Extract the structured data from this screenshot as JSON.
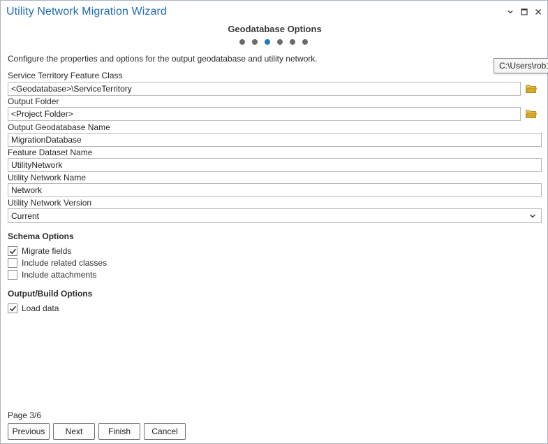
{
  "window": {
    "title": "Utility Network Migration Wizard",
    "minimize_icon": "chevron-down-icon",
    "maximize_icon": "maximize-icon",
    "close_icon": "close-icon"
  },
  "step": {
    "title": "Geodatabase Options",
    "total": 6,
    "current": 3
  },
  "intro": "Configure the properties and options for the output geodatabase and utility network.",
  "tooltip": "C:\\Users\\rob1",
  "fields": {
    "service_territory": {
      "label": "Service Territory Feature Class",
      "value": "<Geodatabase>\\ServiceTerritory"
    },
    "output_folder": {
      "label": "Output Folder",
      "value": "<Project Folder>"
    },
    "gdb_name": {
      "label": "Output Geodatabase Name",
      "value": "MigrationDatabase"
    },
    "dataset_name": {
      "label": "Feature Dataset Name",
      "value": "UtilityNetwork"
    },
    "network_name": {
      "label": "Utility Network Name",
      "value": "Network"
    },
    "network_version": {
      "label": "Utility Network Version",
      "value": "Current"
    }
  },
  "schema": {
    "title": "Schema Options",
    "options": [
      {
        "label": "Migrate fields",
        "checked": true
      },
      {
        "label": "Include related classes",
        "checked": false
      },
      {
        "label": "Include attachments",
        "checked": false
      }
    ]
  },
  "output": {
    "title": "Output/Build Options",
    "options": [
      {
        "label": "Load data",
        "checked": true
      }
    ]
  },
  "page_indicator": "Page 3/6",
  "buttons": {
    "previous": "Previous",
    "next": "Next",
    "finish": "Finish",
    "cancel": "Cancel"
  },
  "colors": {
    "title": "#1f6cb4",
    "active_dot": "#1f7ac4",
    "folder": "#d4a92c"
  }
}
